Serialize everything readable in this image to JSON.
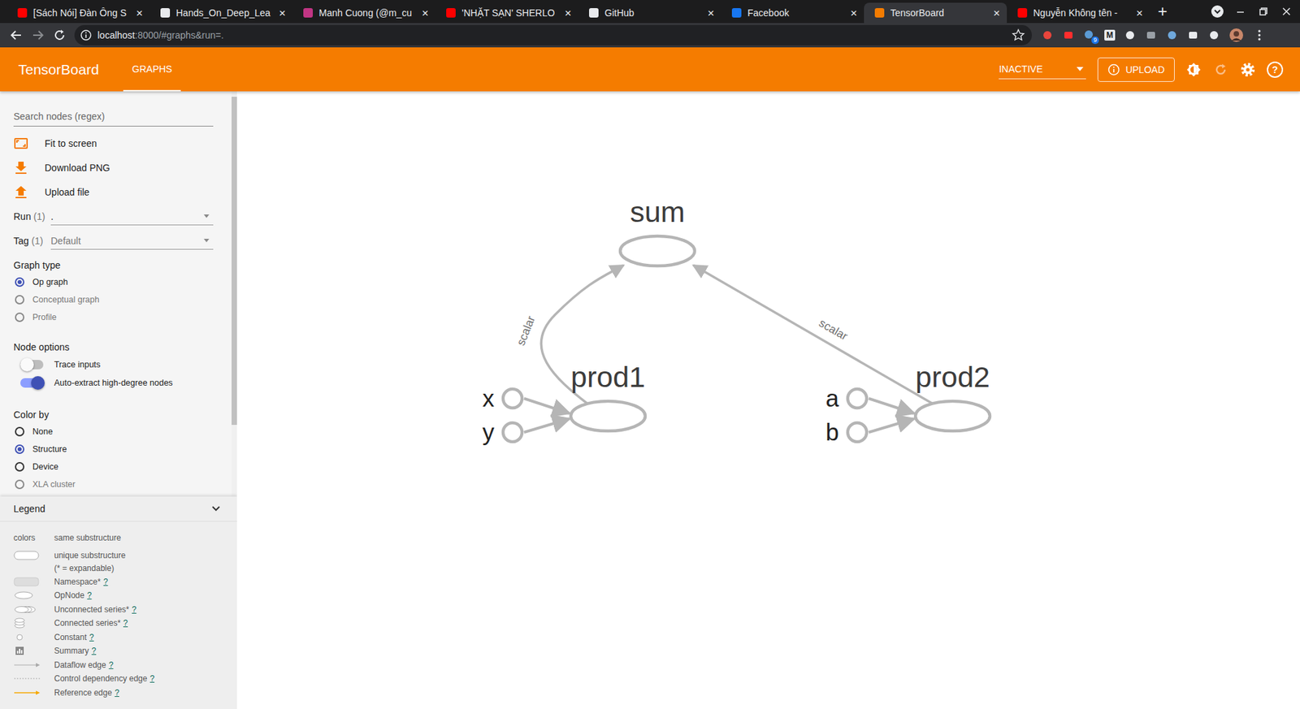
{
  "browser": {
    "tabs": [
      {
        "title": "[Sách Nói] Đàn Ông S",
        "selected": false,
        "color": "#ff0000"
      },
      {
        "title": "Hands_On_Deep_Lea",
        "selected": false,
        "color": "#e8eaed"
      },
      {
        "title": "Manh Cuong (@m_cu",
        "selected": false,
        "color": "#c13584"
      },
      {
        "title": "'NHẶT SẠN' SHERLO",
        "selected": false,
        "color": "#ff0000"
      },
      {
        "title": "GitHub",
        "selected": false,
        "color": "#e8eaed"
      },
      {
        "title": "Facebook",
        "selected": false,
        "color": "#1877f2"
      },
      {
        "title": "TensorBoard",
        "selected": true,
        "color": "#f57c00"
      },
      {
        "title": "Nguyễn Không tên -",
        "selected": false,
        "color": "#ff0000"
      }
    ],
    "tab_close": "×",
    "new_tab": "+",
    "address": {
      "host": "localhost",
      "rest": ":8000/#graphs&run=."
    },
    "extension_letter": "M",
    "extension_badge": "9"
  },
  "header": {
    "title": "TensorBoard",
    "tabs": [
      {
        "label": "GRAPHS",
        "selected": true
      }
    ],
    "status": "INACTIVE",
    "upload": "UPLOAD",
    "help": "?"
  },
  "sidebar": {
    "search": {
      "placeholder": "Search nodes (regex)"
    },
    "actions": [
      "Fit to screen",
      "Download PNG",
      "Upload file"
    ],
    "selects": [
      {
        "label": "Run",
        "count": "(1)",
        "value": ".",
        "placeholder": false
      },
      {
        "label": "Tag",
        "count": "(1)",
        "value": "Default",
        "placeholder": true
      }
    ],
    "graph_type": {
      "title": "Graph type",
      "options": [
        {
          "label": "Op graph",
          "selected": true,
          "disabled": false
        },
        {
          "label": "Conceptual graph",
          "selected": false,
          "disabled": true
        },
        {
          "label": "Profile",
          "selected": false,
          "disabled": true
        }
      ]
    },
    "node_options": {
      "title": "Node options",
      "toggles": [
        {
          "label": "Trace inputs",
          "on": false
        },
        {
          "label": "Auto-extract high-degree nodes",
          "on": true
        }
      ]
    },
    "color_by": {
      "title": "Color by",
      "options": [
        {
          "label": "None",
          "selected": false,
          "disabled": false
        },
        {
          "label": "Structure",
          "selected": true,
          "disabled": false
        },
        {
          "label": "Device",
          "selected": false,
          "disabled": false
        },
        {
          "label": "XLA cluster",
          "selected": false,
          "disabled": true
        }
      ]
    },
    "scroll_level": 0.81
  },
  "legend": {
    "title": "Legend",
    "expanded": true,
    "items": [
      {
        "kind": "colors",
        "symbol": "colors",
        "label": "same substructure"
      },
      {
        "kind": "unique",
        "label": "unique substructure",
        "note": "(* = expandable)"
      },
      {
        "kind": "namespace",
        "label": "Namespace*",
        "help": "?"
      },
      {
        "kind": "opnode",
        "label": "OpNode",
        "help": "?"
      },
      {
        "kind": "unconnected",
        "label": "Unconnected series*",
        "help": "?"
      },
      {
        "kind": "connected",
        "label": "Connected series*",
        "help": "?"
      },
      {
        "kind": "constant",
        "label": "Constant",
        "help": "?"
      },
      {
        "kind": "summary",
        "label": "Summary",
        "help": "?"
      },
      {
        "kind": "dataflow",
        "label": "Dataflow edge",
        "help": "?"
      },
      {
        "kind": "control",
        "label": "Control dependency edge",
        "help": "?"
      },
      {
        "kind": "reference",
        "label": "Reference edge",
        "help": "?"
      }
    ]
  },
  "graph": {
    "nodes": [
      {
        "name": "sum",
        "kind": "op",
        "inputs": []
      },
      {
        "name": "prod1",
        "kind": "op",
        "inputs": [
          "x",
          "y"
        ]
      },
      {
        "name": "prod2",
        "kind": "op",
        "inputs": [
          "a",
          "b"
        ]
      },
      {
        "name": "x",
        "kind": "const",
        "inputs": []
      },
      {
        "name": "y",
        "kind": "const",
        "inputs": []
      },
      {
        "name": "a",
        "kind": "const",
        "inputs": []
      },
      {
        "name": "b",
        "kind": "const",
        "inputs": []
      }
    ],
    "edges": [
      {
        "from": "prod1",
        "to": "sum",
        "label": "scalar"
      },
      {
        "from": "prod2",
        "to": "sum",
        "label": "scalar"
      }
    ]
  }
}
